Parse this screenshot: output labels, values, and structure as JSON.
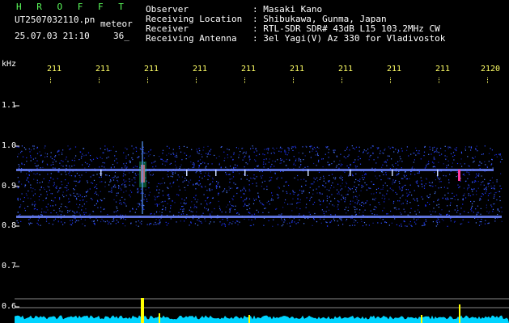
{
  "header": {
    "brand": "H R O F F T",
    "filename": "UT2507032110.pn",
    "filename_suffix": "meteor",
    "datetime": "25.07.03 21:10",
    "count": "36_",
    "fields": [
      {
        "label": "Observer",
        "value": ": Masaki Kano"
      },
      {
        "label": "Receiving Location",
        "value": ": Shibukawa, Gunma, Japan"
      },
      {
        "label": "Receiver",
        "value": ": RTL-SDR SDR# 43dB L15 103.2MHz CW"
      },
      {
        "label": "Receiving Antenna",
        "value": ": 3el Yagi(V) Az 330 for Vladivostok"
      }
    ]
  },
  "axes": {
    "y_unit": "kHz",
    "y_ticks": [
      "1.1",
      "1.0",
      "0.9",
      "0.8",
      "0.7",
      "0.6"
    ],
    "x_ticks": [
      "211",
      "211",
      "211",
      "211",
      "211",
      "211",
      "211",
      "211",
      "211",
      "2120"
    ]
  },
  "colors": {
    "background": "#000000",
    "text": "#ffffff",
    "brand": "#5cff5c",
    "tick": "#ffff66",
    "noise": "#1a3cff",
    "signal": "#ff3366",
    "baseline": "#00e5ff",
    "spike": "#ffff00"
  }
}
